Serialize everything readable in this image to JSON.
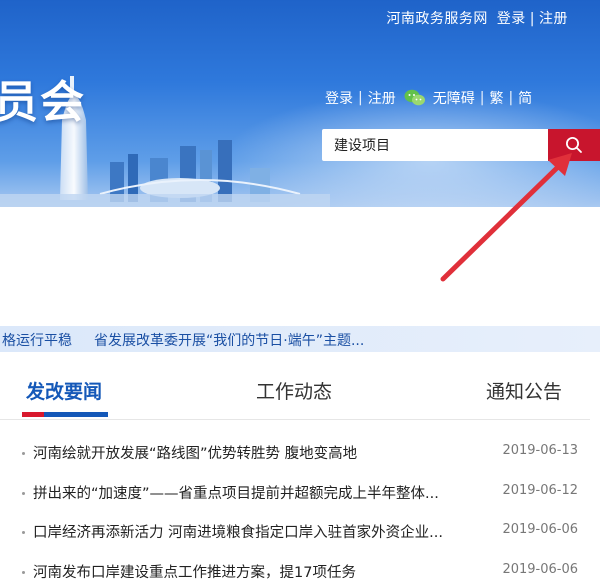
{
  "header": {
    "portal_name": "河南政务服务网",
    "portal_login": "登录",
    "portal_register": "注册",
    "site_title_fragment": "员会"
  },
  "utility": {
    "login": "登录",
    "register": "注册",
    "accessibility": "无障碍",
    "traditional": "繁",
    "simplified": "简",
    "wechat_icon": "wechat-icon"
  },
  "search": {
    "value": "建设项目",
    "button_icon": "search-icon"
  },
  "ticker": {
    "items": [
      "格运行平稳",
      "省发展改革委开展“我们的节日·端午”主题..."
    ]
  },
  "tabs": [
    {
      "label": "发改要闻",
      "active": true
    },
    {
      "label": "工作动态",
      "active": false
    },
    {
      "label": "通知公告",
      "active": false
    }
  ],
  "news": [
    {
      "title": "河南绘就开放发展“路线图”优势转胜势 腹地变高地",
      "date": "2019-06-13"
    },
    {
      "title": "拼出来的“加速度”——省重点项目提前并超额完成上半年整体...",
      "date": "2019-06-12"
    },
    {
      "title": "口岸经济再添新活力 河南进境粮食指定口岸入驻首家外资企业...",
      "date": "2019-06-06"
    },
    {
      "title": "河南发布口岸建设重点工作推进方案，提17项任务",
      "date": "2019-06-06"
    }
  ],
  "colors": {
    "banner_blue": "#2f79dc",
    "accent_red": "#c8152d",
    "tab_blue": "#1458b8",
    "arrow_red": "#e0303a"
  }
}
